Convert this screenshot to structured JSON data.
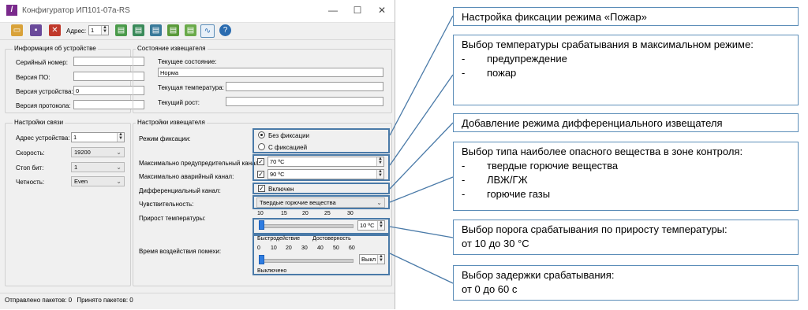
{
  "window": {
    "title": "Конфигуратор ИП101-07а-RS",
    "logo_glyph": "/",
    "minimize": "—",
    "maximize": "☐",
    "close": "✕"
  },
  "toolbar": {
    "address_label": "Адрес:",
    "address_value": "1",
    "icons": [
      "open-icon",
      "save-icon",
      "reset-icon",
      "read-icon",
      "write-icon",
      "read-all-icon",
      "write-all-icon",
      "export-icon",
      "monitor-icon",
      "help-icon"
    ]
  },
  "device_info": {
    "title": "Информация об устройстве",
    "serial_label": "Серийный номер:",
    "serial_value": "",
    "fw_label": "Версия ПО:",
    "fw_value": "",
    "device_ver_label": "Версия устройства:",
    "device_ver_value": "0",
    "protocol_label": "Версия протокола:",
    "protocol_value": ""
  },
  "detector_state": {
    "title": "Состояние извещателя",
    "current_label": "Текущее состояние:",
    "current_value": "Норма",
    "temp_label": "Текущая температура:",
    "temp_value": "",
    "growth_label": "Текущий рост:",
    "growth_value": ""
  },
  "comm": {
    "title": "Настройки связи",
    "addr_label": "Адрес устройства:",
    "addr_value": "1",
    "speed_label": "Скорость:",
    "speed_value": "19200",
    "stop_label": "Стоп бит:",
    "stop_value": "1",
    "parity_label": "Четность:",
    "parity_value": "Even"
  },
  "detector_settings": {
    "title": "Настройки извещателя",
    "fix_mode_label": "Режим фиксации:",
    "fix_opt1": "Без фиксации",
    "fix_opt2": "С фиксацией",
    "max_warn_label": "Максимально предупредительный канал:",
    "max_warn_value": "70 ºC",
    "max_alarm_label": "Максимально аварийный канал:",
    "max_alarm_value": "90 ºC",
    "diff_label": "Дифференциальный канал:",
    "diff_value": "Включен",
    "sens_label": "Чувствительность:",
    "sens_value": "Твердые горючие вещества",
    "rise_label": "Прирост температуры:",
    "rise_ticks": [
      "10",
      "15",
      "20",
      "25",
      "30"
    ],
    "rise_value": "10 ºC",
    "rise_level": 10,
    "interf_label": "Время воздействия помехи:",
    "interf_cap1": "Быстродействие",
    "interf_cap2": "Достоверность",
    "interf_ticks": [
      "0",
      "10",
      "20",
      "30",
      "40",
      "50",
      "60"
    ],
    "interf_value": "Выкл",
    "interf_state": "Выключено",
    "interf_level": 0
  },
  "status": {
    "sent": "Отправлено пакетов: 0",
    "received": "Принято пакетов: 0"
  },
  "callouts": {
    "c1": "Настройка фиксации режима «Пожар»",
    "c2_title": "Выбор температуры срабатывания в максимальном режиме:",
    "c2_items": [
      "предупреждение",
      "пожар"
    ],
    "c3": "Добавление режима дифференциального извещателя",
    "c4_title": "Выбор типа наиболее опасного вещества в зоне контроля:",
    "c4_items": [
      "твердые горючие вещества",
      "ЛВЖ/ГЖ",
      "горючие газы"
    ],
    "c5_title": "Выбор порога срабатывания по приросту температуры:",
    "c5_line2": "от 10 до 30 °С",
    "c6_title": "Выбор задержки срабатывания:",
    "c6_line2": "от 0 до 60 с",
    "bullet": "-"
  },
  "colors": {
    "highlight": "#4a7aa8",
    "slider_thumb": "#2f7de1"
  }
}
